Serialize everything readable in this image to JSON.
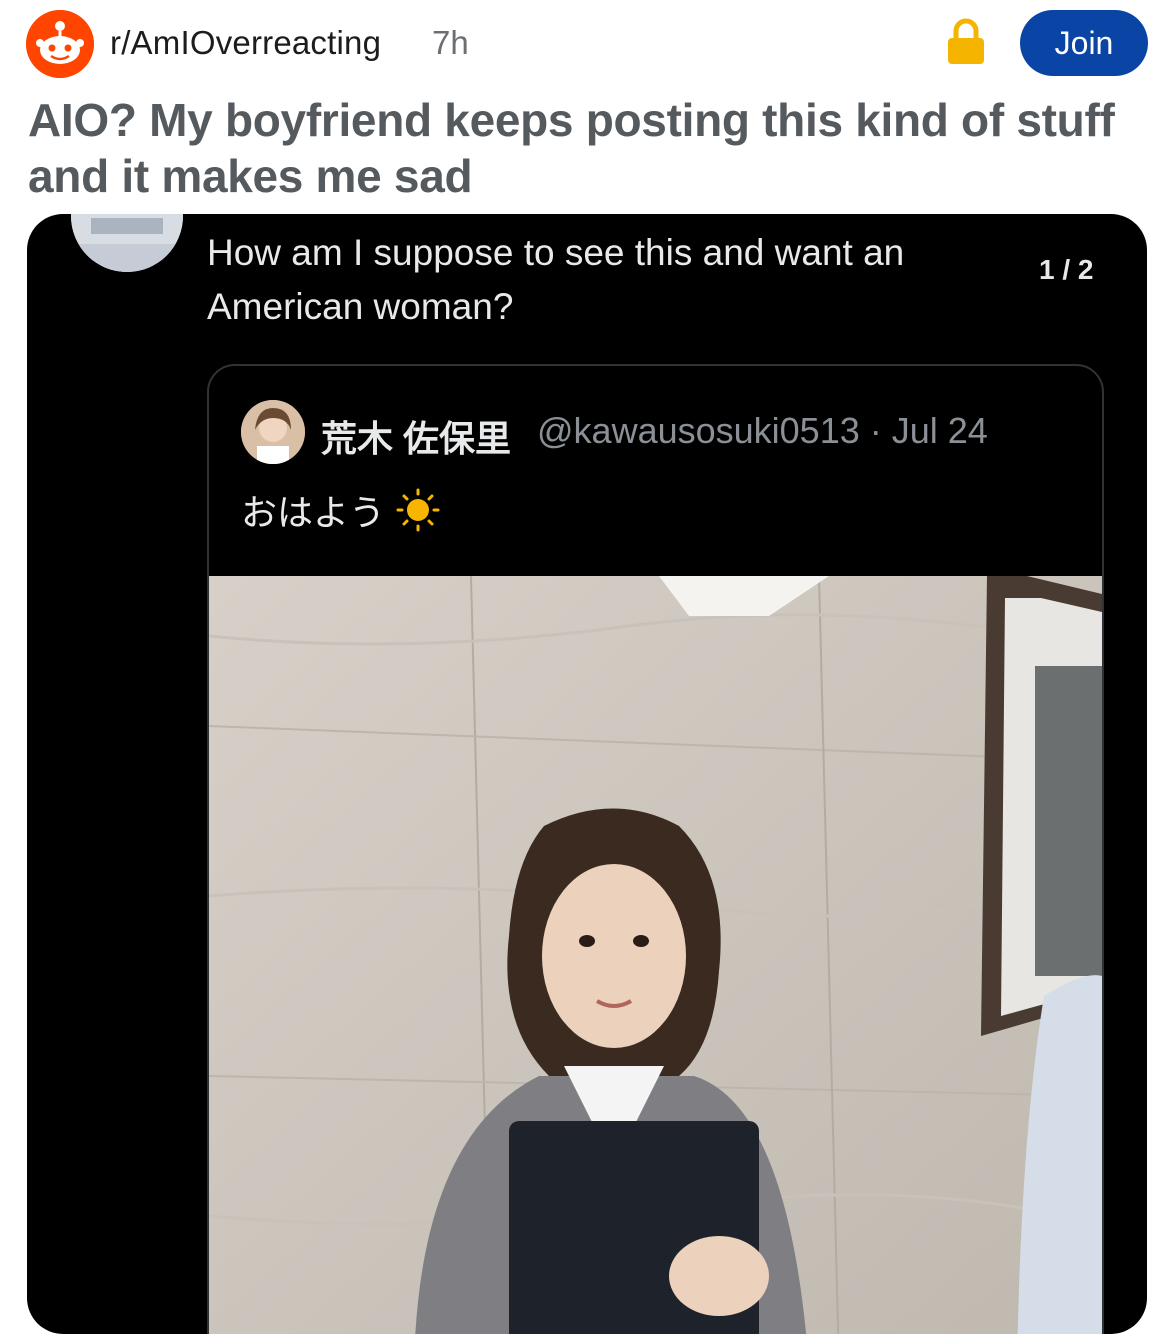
{
  "header": {
    "subreddit": "r/AmIOverreacting",
    "age": "7h",
    "join_label": "Join",
    "icons": [
      "reddit-snoo-avatar",
      "lock-icon"
    ]
  },
  "post": {
    "title": "AIO? My boyfriend keeps posting this kind of stuff and it makes me sad"
  },
  "tweet": {
    "text": "How am I suppose to see this and want an American woman?",
    "page_counter": "1 / 2",
    "quoted": {
      "display_name": "荒木 佐保里",
      "meta": "@kawausosuki0513 · Jul 24",
      "body": "おはよう"
    }
  },
  "colors": {
    "join_button": "#0a45a6",
    "subreddit_avatar": "#ff4500",
    "card_background": "#000000",
    "lock": "#f5b400"
  }
}
